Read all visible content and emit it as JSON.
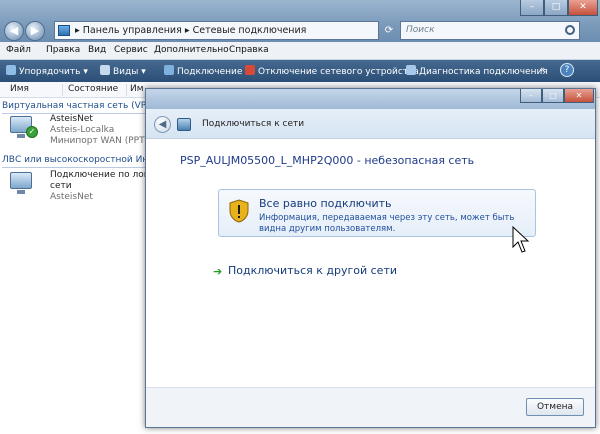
{
  "explorer": {
    "breadcrumb": "▸ Панель управления ▸ Сетевые подключения",
    "search_placeholder": "Поиск",
    "menu": [
      "Файл",
      "Правка",
      "Вид",
      "Сервис",
      "Дополнительно",
      "Справка"
    ],
    "toolbar": {
      "organize": "Упорядочить",
      "views": "Виды",
      "connect": "Подключение",
      "disconnect": "Отключение сетевого устройства",
      "diagnose": "Диагностика подключения",
      "more": "»"
    },
    "columns": [
      "Имя",
      "Состояние",
      "Им"
    ],
    "groups": {
      "vpn": "Виртуальная частная сеть (VPN)",
      "lan": "ЛВС или высокоскоростной Инт"
    },
    "items": [
      {
        "name": "AsteisNet",
        "line2": "Asteis-Localka",
        "line3": "Минипорт WAN (PPTP)"
      },
      {
        "name": "Подключение по локал",
        "line2": "сети",
        "line3": "AsteisNet"
      }
    ]
  },
  "dialog": {
    "title": "Подключиться к сети",
    "network_name": "PSP_AULJM05500_L_MHP2Q000 - небезопасная сеть",
    "option_title": "Все равно подключить",
    "option_desc": "Информация, передаваемая через эту сеть, может быть видна другим пользователям.",
    "other_network": "Подключиться к другой сети",
    "cancel": "Отмена"
  }
}
